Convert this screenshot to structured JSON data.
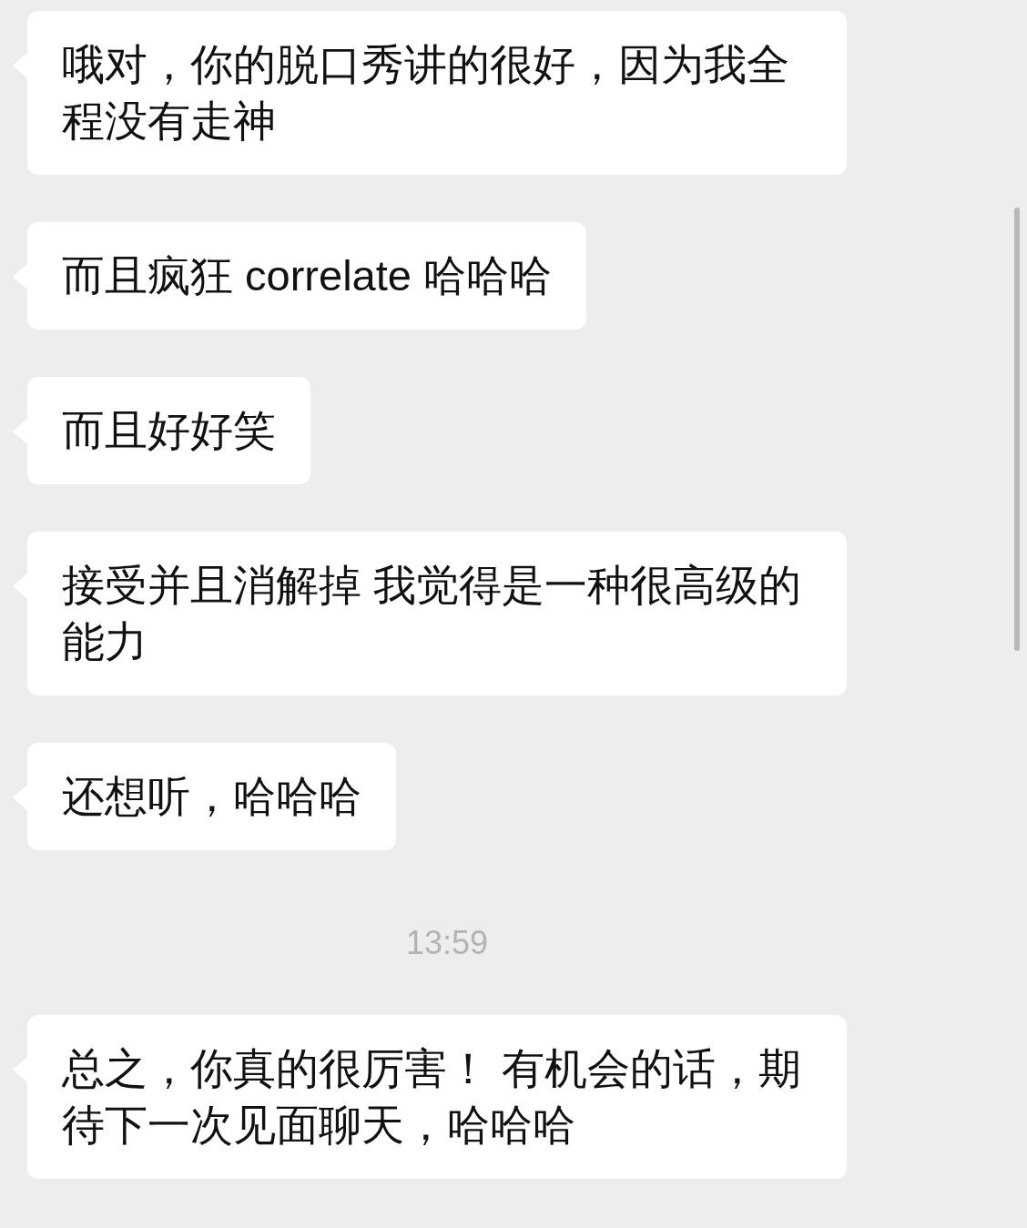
{
  "messages": [
    {
      "kind": "bubble",
      "text": "哦对，你的脱口秀讲的很好，因为我全程没有走神"
    },
    {
      "kind": "bubble",
      "text": "而且疯狂 correlate 哈哈哈"
    },
    {
      "kind": "bubble",
      "text": "而且好好笑"
    },
    {
      "kind": "bubble",
      "text": "接受并且消解掉 我觉得是一种很高级的能力"
    },
    {
      "kind": "bubble",
      "text": "还想听，哈哈哈"
    },
    {
      "kind": "timestamp",
      "text": "13:59"
    },
    {
      "kind": "bubble",
      "text": "总之，你真的很厉害！ 有机会的话，期待下一次见面聊天，哈哈哈"
    }
  ]
}
